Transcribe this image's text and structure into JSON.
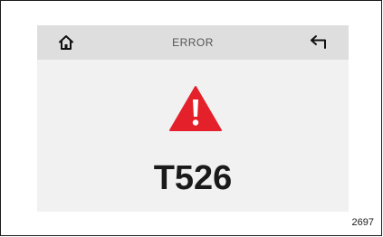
{
  "header": {
    "title": "ERROR",
    "left_icon": "home-icon",
    "right_icon": "back-arrow-icon"
  },
  "alert": {
    "icon": "warning-icon",
    "icon_color": "#e4212b",
    "code": "T526"
  },
  "figure_reference": "2697"
}
